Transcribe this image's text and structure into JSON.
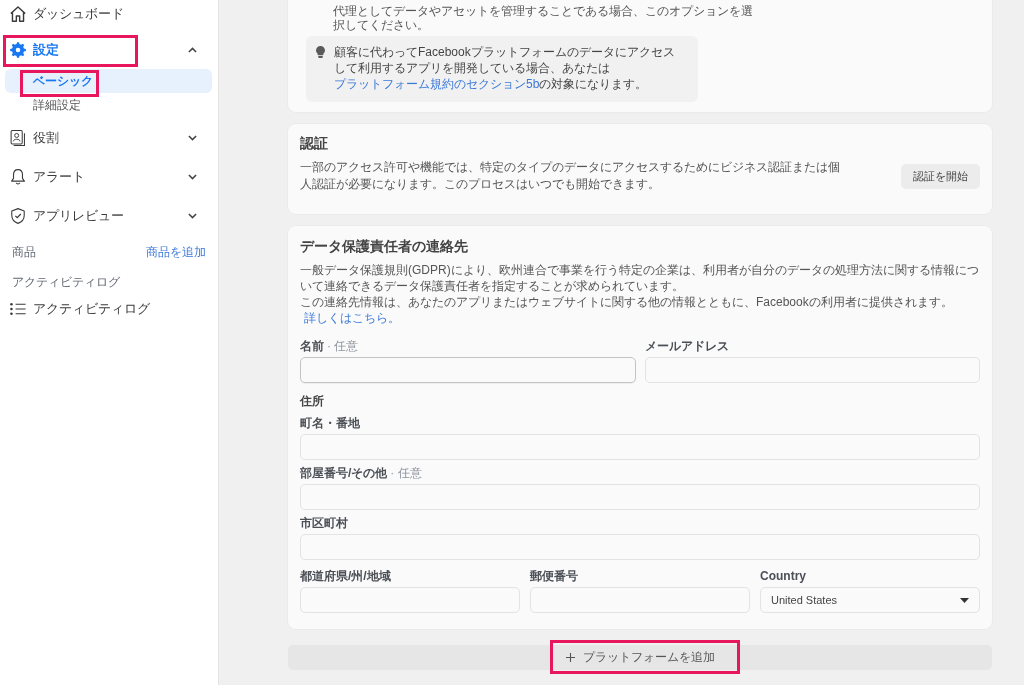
{
  "sidebar": {
    "items": [
      {
        "kind": "link",
        "label": "ダッシュボード",
        "selected": false,
        "highlighted": false
      },
      {
        "kind": "group",
        "label": "設定",
        "selected": true,
        "expanded": true,
        "highlighted": true,
        "children": [
          {
            "label": "ベーシック",
            "selected": true,
            "highlighted": true
          },
          {
            "label": "詳細設定",
            "selected": false,
            "highlighted": false
          }
        ]
      },
      {
        "kind": "group",
        "label": "役割",
        "selected": false,
        "expanded": false,
        "highlighted": false
      },
      {
        "kind": "group",
        "label": "アラート",
        "selected": false,
        "expanded": false,
        "highlighted": false
      },
      {
        "kind": "group",
        "label": "アプリレビュー",
        "selected": false,
        "expanded": false,
        "highlighted": false
      },
      {
        "kind": "section",
        "label": "商品",
        "action": "商品を追加"
      },
      {
        "kind": "section",
        "label": "アクティビティログ"
      },
      {
        "kind": "link",
        "label": "アクティビティログ",
        "selected": false,
        "highlighted": false
      }
    ]
  },
  "intro_card": {
    "text": "代理としてデータやアセットを管理することである場合、このオプションを選択してください。",
    "tip": {
      "text": "顧客に代わってFacebookプラットフォームのデータにアクセスして利用するアプリを開発している場合、あなたは",
      "link": "プラットフォーム規約のセクション5b",
      "text_after": "の対象になります。"
    }
  },
  "verification_card": {
    "title": "認証",
    "text": "一部のアクセス許可や機能では、特定のタイプのデータにアクセスするためにビジネス認証または個人認証が必要になります。このプロセスはいつでも開始できます。",
    "button": "認証を開始"
  },
  "contact_card": {
    "title": "データ保護責任者の連絡先",
    "paragraphs": [
      {
        "text": "一般データ保護規則(GDPR)により、欧州連合で事業を行う特定の企業は、利用者が自分のデータの処理方法に関する情報について連絡できるデータ保護責任者を指定することが求められています。"
      },
      {
        "text": "この連絡先情報は、あなたのアプリまたはウェブサイトに関する他の情報とともに、Facebookの利用者に提供されます。",
        "link": "詳しくはこちら。"
      }
    ],
    "form": [
      {
        "kind": "fields",
        "fields": [
          {
            "kind": "text",
            "label": "名前",
            "note": "· 任意",
            "focused": true
          },
          {
            "kind": "text",
            "label": "メールアドレス",
            "focused": false
          }
        ]
      },
      {
        "kind": "heading",
        "text": "住所"
      },
      {
        "kind": "fields",
        "fields": [
          {
            "kind": "text",
            "label": "町名・番地",
            "focused": false
          }
        ]
      },
      {
        "kind": "fields",
        "fields": [
          {
            "kind": "text",
            "label": "部屋番号/その他",
            "note": "· 任意",
            "focused": false
          }
        ]
      },
      {
        "kind": "fields",
        "fields": [
          {
            "kind": "text",
            "label": "市区町村",
            "focused": false
          }
        ]
      },
      {
        "kind": "fields",
        "fields": [
          {
            "kind": "text",
            "label": "都道府県/州/地域",
            "focused": false
          },
          {
            "kind": "text",
            "label": "郵便番号",
            "focused": false
          },
          {
            "kind": "select",
            "label": "Country",
            "value": "United States",
            "focused": false
          }
        ]
      }
    ]
  },
  "add_platform": {
    "label": "プラットフォームを追加",
    "highlighted": true
  }
}
